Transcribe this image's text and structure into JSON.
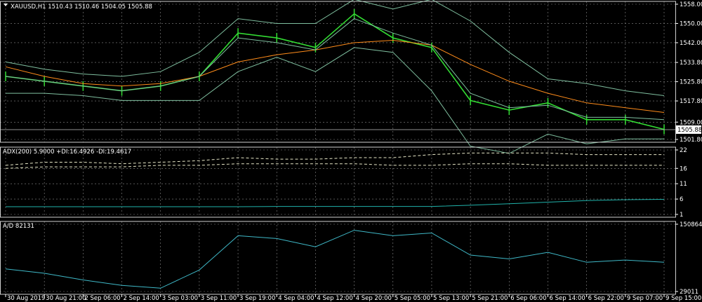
{
  "chart_data": [
    {
      "type": "line",
      "panel": "price",
      "title": "XAUUSD,H1  1510.43 1510.46 1504.05 1505.88",
      "symbol": "XAUUSD",
      "timeframe": "H1",
      "ohlc": {
        "open": 1510.43,
        "high": 1510.46,
        "low": 1504.05,
        "close": 1505.88
      },
      "current_price_label": "1505.88",
      "ylim": [
        1501.8,
        1558.0
      ],
      "yticks": [
        "1558.00",
        "1550.00",
        "1542.00",
        "1533.80",
        "1525.80",
        "1517.80",
        "1509.00",
        "1501.80"
      ],
      "x": [
        "30 Aug 2019",
        "30 Aug 21:00",
        "2 Sep 06:00",
        "2 Sep 14:00",
        "3 Sep 03:00",
        "3 Sep 11:00",
        "3 Sep 19:00",
        "4 Sep 04:00",
        "4 Sep 12:00",
        "4 Sep 20:00",
        "5 Sep 05:00",
        "5 Sep 13:00",
        "5 Sep 21:00",
        "6 Sep 06:00",
        "6 Sep 14:00",
        "6 Sep 22:00",
        "9 Sep 07:00",
        "9 Sep 15:00"
      ],
      "series": [
        {
          "role": "price",
          "color": "#33dd33",
          "values": [
            1528,
            1526,
            1524,
            1522,
            1524,
            1528,
            1546,
            1544,
            1540,
            1554,
            1544,
            1540,
            1518,
            1514,
            1517,
            1510,
            1510,
            1506
          ]
        },
        {
          "role": "moving-average",
          "color": "#ff8c1a",
          "values": [
            1532,
            1528,
            1525,
            1524,
            1525,
            1528,
            1534,
            1537,
            1539,
            1542,
            1543,
            1541,
            1533,
            1526,
            1521,
            1517,
            1515,
            1513
          ]
        },
        {
          "role": "bollinger-upper",
          "color": "#7fbf9f",
          "values": [
            1534,
            1531,
            1529,
            1528,
            1530,
            1538,
            1552,
            1550,
            1550,
            1560,
            1556,
            1560,
            1551,
            1538,
            1527,
            1525,
            1522,
            1520
          ]
        },
        {
          "role": "bollinger-middle",
          "color": "#7fbf9f",
          "values": [
            1528,
            1526,
            1524,
            1522,
            1524,
            1528,
            1544,
            1542,
            1539,
            1552,
            1546,
            1541,
            1521,
            1515,
            1516,
            1511,
            1511,
            1510
          ]
        },
        {
          "role": "bollinger-lower",
          "color": "#7fbf9f",
          "values": [
            1521,
            1521,
            1520,
            1518,
            1518,
            1518,
            1530,
            1536,
            1530,
            1540,
            1538,
            1522,
            1499,
            1496,
            1504,
            1500,
            1502,
            1502
          ]
        }
      ]
    },
    {
      "type": "line",
      "panel": "adx",
      "title": "ADX(200) 5.9000 +DI:16.4926 -DI:19.4617",
      "ylim": [
        1,
        22
      ],
      "yticks": [
        "22",
        "16",
        "11",
        "6",
        "1"
      ],
      "series": [
        {
          "role": "plus-di",
          "color": "#e8e8c8",
          "dashed": true,
          "values": [
            17,
            18,
            18,
            17.5,
            18,
            18.5,
            19.5,
            19,
            19,
            19.5,
            19.5,
            20.5,
            21,
            21,
            21,
            20.5,
            20.5,
            20.5
          ]
        },
        {
          "role": "minus-di",
          "color": "#e8e8c8",
          "dashed": true,
          "values": [
            16,
            16.5,
            16.5,
            16.5,
            17,
            17,
            17.5,
            17.5,
            17.5,
            17.5,
            17,
            17,
            17.5,
            17.5,
            17,
            17,
            17,
            17
          ]
        },
        {
          "role": "adx",
          "color": "#20b2aa",
          "values": [
            3.5,
            3.5,
            3.5,
            3.5,
            3.5,
            3.5,
            3.5,
            3.6,
            3.6,
            3.6,
            3.6,
            3.6,
            4,
            4.5,
            5,
            5.5,
            5.8,
            5.9
          ]
        }
      ]
    },
    {
      "type": "line",
      "panel": "ad",
      "title": "A/D 82131",
      "ylim": [
        29011,
        150864
      ],
      "yticks": [
        "150864",
        "29011"
      ],
      "series": [
        {
          "role": "accumulation-distribution",
          "color": "#3fb9c8",
          "values": [
            70000,
            62000,
            50000,
            40000,
            35000,
            68000,
            130000,
            125000,
            110000,
            140000,
            130000,
            135000,
            95000,
            88000,
            100000,
            82000,
            86000,
            82131
          ]
        }
      ]
    }
  ]
}
